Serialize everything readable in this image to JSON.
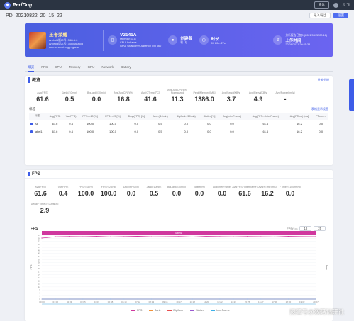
{
  "app": {
    "name": "PerfDog",
    "lang": "简体",
    "user": "科 飞"
  },
  "page": {
    "title": "PD_20210822_20_15_22",
    "btn_export": "导入/导出",
    "btn_settings": "设置"
  },
  "banner": {
    "game_name": "王者荣耀",
    "game_lines": [
      "Android版本号: 3.61.1.6",
      "Android版本号: 3650160B03",
      "com.tencent.tmgp.sgame"
    ],
    "device_name": "V2141A",
    "device_lines": [
      "Memory: 11G",
      "CPU: kohaina",
      "GPU: Qualcomm Adreno (TM) 660"
    ],
    "creator_label": "创建者",
    "creator_value": "科 飞",
    "duration_label": "时长",
    "duration_value": "0h 20m 27s",
    "upload_hint": "分析报告已加入(2021/08/22 20:16)",
    "upload_label": "上传时间",
    "upload_value": "22/08/2021 20:21:38"
  },
  "tabs": [
    "概览",
    "FPS",
    "CPU",
    "Memory",
    "GPU",
    "Network",
    "Battery"
  ],
  "overview": {
    "title": "概览",
    "link": "性能分析",
    "metrics": [
      {
        "label": "Avg(FPS)",
        "value": "61.6"
      },
      {
        "label": "Jank(/10min)",
        "value": "0.5"
      },
      {
        "label": "BigJank(/10min)",
        "value": "0.0"
      },
      {
        "label": "Avg(AppCPU)[%]",
        "value": "16.8"
      },
      {
        "label": "Avg(CTemp)[°C]",
        "value": "41.6"
      },
      {
        "label": "Avg(AppCPU)[%] Normalized",
        "value": "11.3"
      },
      {
        "label": "Peak(Memory)[MB]",
        "value": "1386.0"
      },
      {
        "label": "Avg(Send)[KB/s]",
        "value": "3.7"
      },
      {
        "label": "Avg(Recv)[KB/s]",
        "value": "4.9"
      },
      {
        "label": "Avg(Power)[mW]",
        "value": "-"
      }
    ],
    "table_title": "标签",
    "table_link": "表格显示设置",
    "columns": [
      "标签",
      "Avg(FPS)",
      "Var(FPS)",
      "FPS>=18 [%]",
      "FPS>=25 [%]",
      "Drop(FPS) [/h]",
      "Jank (/10min)",
      "BigJank (/10min)",
      "Stutter [%]",
      "Avg(InterFrame)",
      "Avg(FPS>=InterFrame)",
      "Avg(FTime) [ms]",
      "FTime>="
    ],
    "rows": [
      [
        "All",
        "61.6",
        "0.4",
        "100.0",
        "100.0",
        "0.0",
        "0.5",
        "0.0",
        "0.0",
        "0.0",
        "61.6",
        "16.2",
        "0.0"
      ],
      [
        "label1",
        "61.6",
        "0.4",
        "100.0",
        "100.0",
        "0.0",
        "0.5",
        "0.0",
        "0.0",
        "0.0",
        "61.6",
        "16.2",
        "0.0"
      ]
    ]
  },
  "fps_section": {
    "title": "FPS",
    "metrics": [
      {
        "label": "Avg(FPS)",
        "value": "61.6"
      },
      {
        "label": "Var(FPS)",
        "value": "0.4"
      },
      {
        "label": "FPS>=18[%]",
        "value": "100.0"
      },
      {
        "label": "FPS>=25[%]",
        "value": "100.0"
      },
      {
        "label": "Drop(FPS)[/h]",
        "value": "0.0"
      },
      {
        "label": "Jank(/10min)",
        "value": "0.5"
      },
      {
        "label": "BigJank(/10min)",
        "value": "0.0"
      },
      {
        "label": "Stutter[%]",
        "value": "0.0"
      },
      {
        "label": "Avg(InterFrame)",
        "value": "0.0"
      },
      {
        "label": "Avg(FPS+InterFrame)",
        "value": "61.6"
      },
      {
        "label": "Avg(FTime)[ms]",
        "value": "16.2"
      },
      {
        "label": "FTime>=100ms[%]",
        "value": "0.0"
      }
    ],
    "extra_metric": {
      "label": "Delta(FTime)>100ms[/h]",
      "value": "2.9"
    },
    "chart_title": "FPS",
    "fps_filter_label": "FPS(<=)",
    "fps_filter_a": "18",
    "fps_filter_b": "25"
  },
  "chart_data": {
    "type": "line",
    "label_bar": "label1",
    "x": [
      "00:00",
      "01:02",
      "02:03",
      "03:05",
      "04:07",
      "05:08",
      "06:10",
      "07:12",
      "08:13",
      "09:15",
      "10:17",
      "11:18",
      "12:20",
      "13:22",
      "14:23",
      "15:25",
      "16:27",
      "17:28",
      "18:30",
      "19:32",
      "20:27"
    ],
    "ylim": [
      0,
      63
    ],
    "yticks": [
      "0",
      "3",
      "6",
      "9",
      "12",
      "15",
      "18",
      "21",
      "24",
      "27",
      "30",
      "33",
      "36",
      "39",
      "42",
      "45",
      "48",
      "51",
      "54",
      "57",
      "60",
      "63"
    ],
    "ylabel": "FPS",
    "y2label": "Jank",
    "series": [
      {
        "name": "FPS",
        "color": "#d0379e",
        "values": [
          60.2,
          61.5,
          61.8,
          61.6,
          61.9,
          61.4,
          61.7,
          62.0,
          61.5,
          61.6,
          61.8,
          61.3,
          61.9,
          61.7,
          61.5,
          61.8,
          61.6,
          61.4,
          61.9,
          61.7,
          61.6
        ]
      },
      {
        "name": "Jank",
        "color": "#f0923a",
        "values": [
          0,
          0,
          0,
          0,
          0,
          0,
          0,
          0,
          0,
          0,
          0,
          0,
          0,
          0,
          0,
          0,
          0,
          0,
          0,
          0,
          0
        ]
      },
      {
        "name": "BigJank",
        "color": "#e85050",
        "values": [
          0,
          0,
          0,
          0,
          0,
          0,
          0,
          0,
          0,
          0,
          0,
          0,
          0,
          0,
          0,
          0,
          0,
          0,
          0,
          0,
          0
        ]
      },
      {
        "name": "Stutter",
        "color": "#9b59d0",
        "values": [
          0,
          0,
          0,
          0,
          0,
          0,
          0,
          0,
          0,
          0,
          0,
          0,
          0,
          0,
          0,
          0,
          0,
          0,
          0,
          0,
          0
        ]
      },
      {
        "name": "InterFrame",
        "color": "#3cb0e8",
        "values": [
          0,
          0,
          0,
          0,
          0,
          0,
          0,
          0,
          0,
          0,
          0,
          0,
          0,
          0,
          0,
          0,
          0,
          0,
          0,
          0,
          0
        ]
      }
    ]
  },
  "watermark": "搜狐号@数码钻研社"
}
